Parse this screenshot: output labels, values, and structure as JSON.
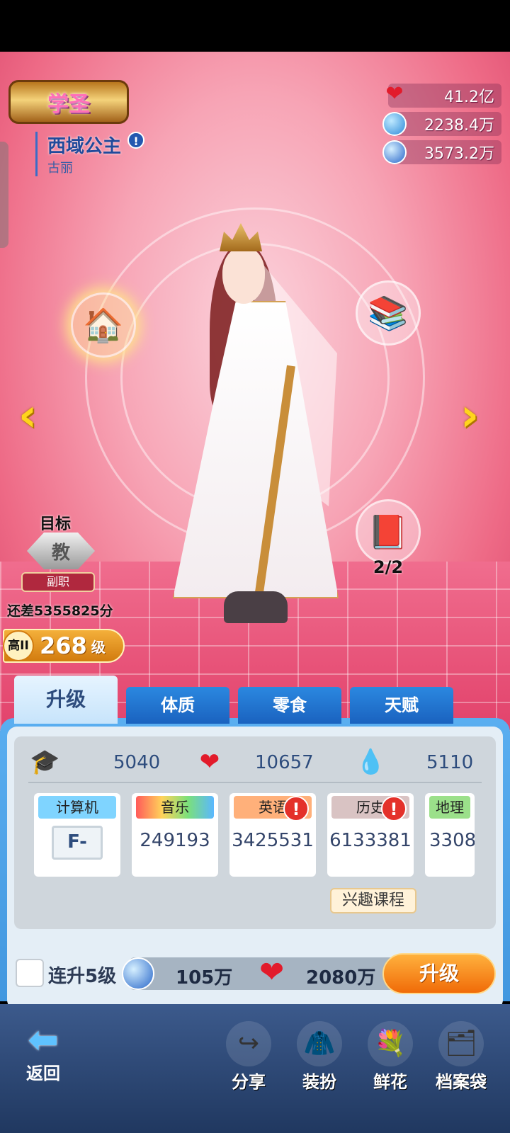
{
  "rank_badge": "学圣",
  "character": {
    "name": "西域公主",
    "subname": "古丽"
  },
  "resources": [
    {
      "icon": "heart-icon",
      "value": "41.2亿"
    },
    {
      "icon": "water-drop-icon",
      "value": "2238.4万"
    },
    {
      "icon": "globe-icon",
      "value": "3573.2万"
    }
  ],
  "book_count": "2/2",
  "target": {
    "label": "目标",
    "emblem": "教",
    "title": "副职",
    "gap": "还差5355825分"
  },
  "level": {
    "grade": "高II",
    "number": "268",
    "unit": "级"
  },
  "tabs": [
    "升级",
    "体质",
    "零食",
    "天赋"
  ],
  "stats": {
    "cap": "5040",
    "heart": "10657",
    "drop": "5110"
  },
  "courses": [
    {
      "name": "计算机",
      "value": "F-",
      "color": "#7fd4ff"
    },
    {
      "name": "音乐",
      "value": "249193",
      "color": "rainbow"
    },
    {
      "name": "英语",
      "value": "3425531",
      "color": "#ffb07a",
      "alert": "!"
    },
    {
      "name": "历史",
      "value": "6133381",
      "color": "#d9c3c3",
      "alert": "!"
    },
    {
      "name": "地理",
      "value": "3308",
      "color": "#9be08a"
    }
  ],
  "interest_course": "兴趣课程",
  "chain": {
    "label": "连升5级",
    "globe_cost": "105万",
    "heart_cost": "2080万",
    "button": "升级"
  },
  "bottom_nav": {
    "back": "返回",
    "items": [
      "分享",
      "装扮",
      "鲜花",
      "档案袋"
    ]
  }
}
